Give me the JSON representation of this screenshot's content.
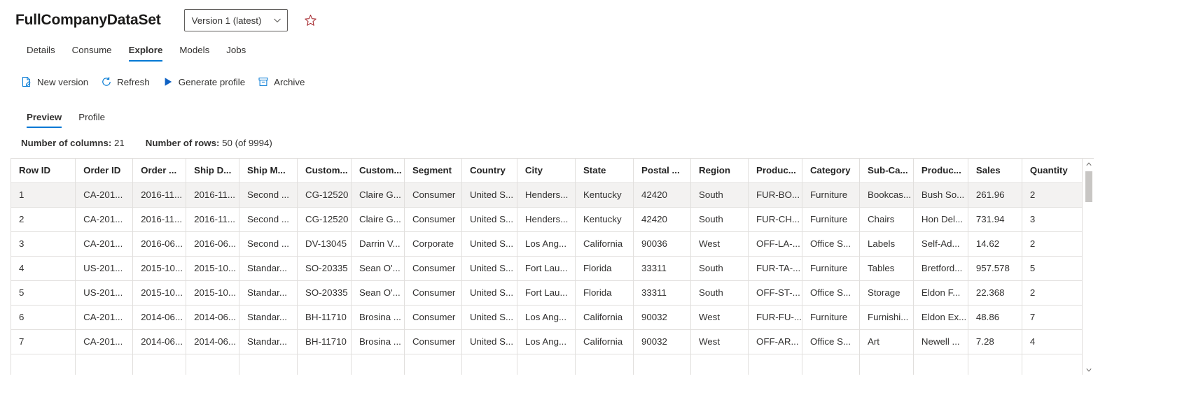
{
  "header": {
    "asset_title": "FullCompanyDataSet",
    "version_label": "Version 1 (latest)",
    "chevron_icon": "chevron-down-icon",
    "favorite_icon": "star-icon"
  },
  "pivot": {
    "items": [
      {
        "label": "Details",
        "selected": false
      },
      {
        "label": "Consume",
        "selected": false
      },
      {
        "label": "Explore",
        "selected": true
      },
      {
        "label": "Models",
        "selected": false
      },
      {
        "label": "Jobs",
        "selected": false
      }
    ]
  },
  "commandbar": {
    "items": [
      {
        "label": "New version",
        "icon": "new-version-icon"
      },
      {
        "label": "Refresh",
        "icon": "refresh-icon"
      },
      {
        "label": "Generate profile",
        "icon": "play-icon"
      },
      {
        "label": "Archive",
        "icon": "archive-icon"
      }
    ]
  },
  "subpivot": {
    "items": [
      {
        "label": "Preview",
        "selected": true
      },
      {
        "label": "Profile",
        "selected": false
      }
    ]
  },
  "stats": {
    "columns_label": "Number of columns:",
    "columns_value": "21",
    "rows_label": "Number of rows:",
    "rows_value": "50 (of 9994)"
  },
  "grid": {
    "columns": [
      "Row ID",
      "Order ID",
      "Order ...",
      "Ship D...",
      "Ship M...",
      "Custom...",
      "Custom...",
      "Segment",
      "Country",
      "City",
      "State",
      "Postal ...",
      "Region",
      "Produc...",
      "Category",
      "Sub-Ca...",
      "Produc...",
      "Sales",
      "Quantity"
    ],
    "rows": [
      {
        "selected": true,
        "cells": [
          "1",
          "CA-201...",
          "2016-11...",
          "2016-11...",
          "Second ...",
          "CG-12520",
          "Claire G...",
          "Consumer",
          "United S...",
          "Henders...",
          "Kentucky",
          "42420",
          "South",
          "FUR-BO...",
          "Furniture",
          "Bookcas...",
          "Bush So...",
          "261.96",
          "2"
        ]
      },
      {
        "selected": false,
        "cells": [
          "2",
          "CA-201...",
          "2016-11...",
          "2016-11...",
          "Second ...",
          "CG-12520",
          "Claire G...",
          "Consumer",
          "United S...",
          "Henders...",
          "Kentucky",
          "42420",
          "South",
          "FUR-CH...",
          "Furniture",
          "Chairs",
          "Hon Del...",
          "731.94",
          "3"
        ]
      },
      {
        "selected": false,
        "cells": [
          "3",
          "CA-201...",
          "2016-06...",
          "2016-06...",
          "Second ...",
          "DV-13045",
          "Darrin V...",
          "Corporate",
          "United S...",
          "Los Ang...",
          "California",
          "90036",
          "West",
          "OFF-LA-...",
          "Office S...",
          "Labels",
          "Self-Ad...",
          "14.62",
          "2"
        ]
      },
      {
        "selected": false,
        "cells": [
          "4",
          "US-201...",
          "2015-10...",
          "2015-10...",
          "Standar...",
          "SO-20335",
          "Sean O'...",
          "Consumer",
          "United S...",
          "Fort Lau...",
          "Florida",
          "33311",
          "South",
          "FUR-TA-...",
          "Furniture",
          "Tables",
          "Bretford...",
          "957.578",
          "5"
        ]
      },
      {
        "selected": false,
        "cells": [
          "5",
          "US-201...",
          "2015-10...",
          "2015-10...",
          "Standar...",
          "SO-20335",
          "Sean O'...",
          "Consumer",
          "United S...",
          "Fort Lau...",
          "Florida",
          "33311",
          "South",
          "OFF-ST-...",
          "Office S...",
          "Storage",
          "Eldon F...",
          "22.368",
          "2"
        ]
      },
      {
        "selected": false,
        "cells": [
          "6",
          "CA-201...",
          "2014-06...",
          "2014-06...",
          "Standar...",
          "BH-11710",
          "Brosina ...",
          "Consumer",
          "United S...",
          "Los Ang...",
          "California",
          "90032",
          "West",
          "FUR-FU-...",
          "Furniture",
          "Furnishi...",
          "Eldon Ex...",
          "48.86",
          "7"
        ]
      },
      {
        "selected": false,
        "cells": [
          "7",
          "CA-201...",
          "2014-06...",
          "2014-06...",
          "Standar...",
          "BH-11710",
          "Brosina ...",
          "Consumer",
          "United S...",
          "Los Ang...",
          "California",
          "90032",
          "West",
          "OFF-AR...",
          "Office S...",
          "Art",
          "Newell ...",
          "7.28",
          "4"
        ]
      },
      {
        "selected": false,
        "cells": [
          "",
          "",
          "",
          "",
          "",
          "",
          "",
          "",
          "",
          "",
          "",
          "",
          "",
          "",
          "",
          "",
          "",
          "",
          ""
        ]
      }
    ],
    "scrollbar": {
      "up_icon": "scroll-up-arrow-icon",
      "down_icon": "scroll-down-arrow-icon",
      "thumb_icon": "scrollbar-thumb"
    }
  },
  "colors": {
    "accent": "#0078d4",
    "border": "#e1dfdd",
    "selected_row": "#f3f2f1",
    "star": "#a4262c"
  }
}
